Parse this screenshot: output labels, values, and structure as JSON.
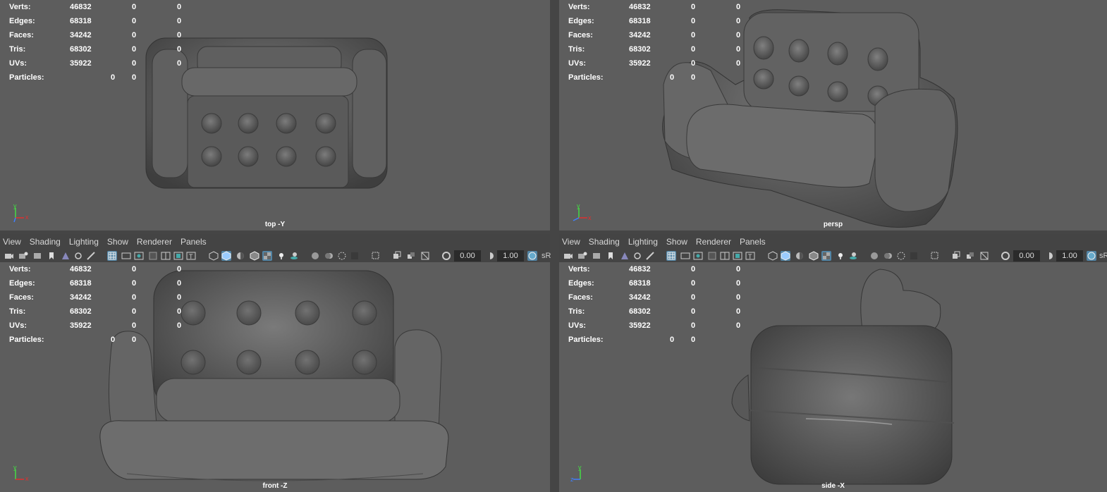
{
  "stats": {
    "verts": {
      "label": "Verts:",
      "count": "46832",
      "sel": "0",
      "tri": "0"
    },
    "edges": {
      "label": "Edges:",
      "count": "68318",
      "sel": "0",
      "tri": "0"
    },
    "faces": {
      "label": "Faces:",
      "count": "34242",
      "sel": "0",
      "tri": "0"
    },
    "tris": {
      "label": "Tris:",
      "count": "68302",
      "sel": "0",
      "tri": "0"
    },
    "uvs": {
      "label": "UVs:",
      "count": "35922",
      "sel": "0",
      "tri": "0"
    },
    "particles": {
      "label": "Particles:",
      "count": "0",
      "sel": "0"
    }
  },
  "viewports": {
    "top": {
      "camera": "top -Y",
      "axis_primary": "y",
      "axis_secondary": "x",
      "axis_third": "z"
    },
    "persp": {
      "camera": "persp",
      "axis_primary": "y",
      "axis_secondary": "x",
      "axis_third": "z"
    },
    "front": {
      "camera": "front -Z",
      "axis_primary": "y",
      "axis_secondary": "x",
      "axis_third": "z"
    },
    "side": {
      "camera": "side -X",
      "axis_primary": "y",
      "axis_secondary": "z",
      "axis_third": "x"
    }
  },
  "menu": {
    "view": "View",
    "shading": "Shading",
    "lighting": "Lighting",
    "show": "Show",
    "renderer": "Renderer",
    "panels": "Panels"
  },
  "toolbar": {
    "exposure": "0.00",
    "gamma": "1.00",
    "color_space": "sR"
  },
  "colors": {
    "viewport_bg": "#5d5d5d",
    "panel_bg": "#444444",
    "accent": "#5285a6",
    "mesh": "#6a6a6a"
  }
}
